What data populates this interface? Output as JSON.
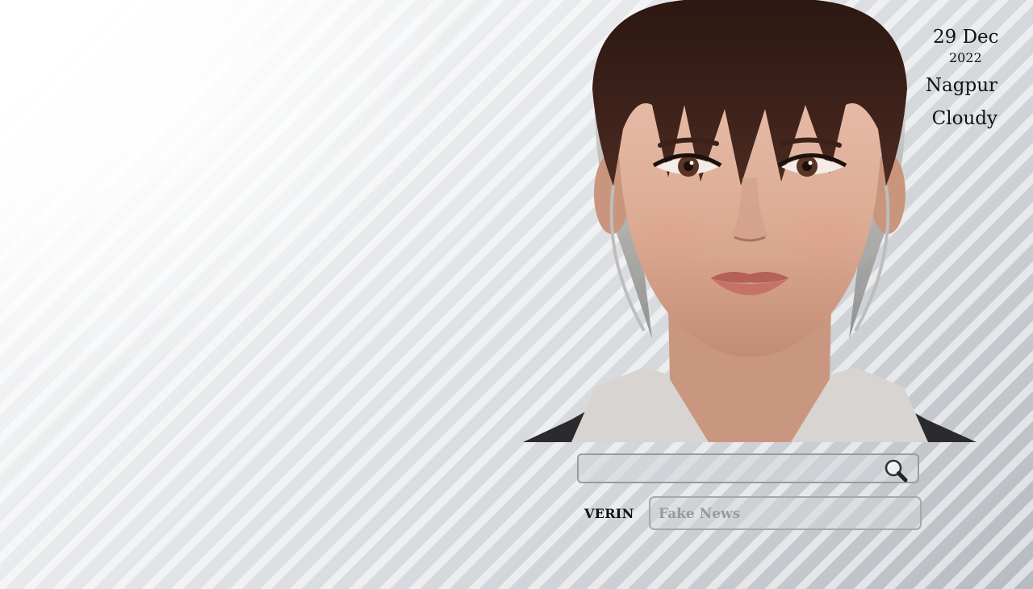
{
  "info": {
    "date_day": "29 Dec",
    "date_year": "2022",
    "city": "Nagpur",
    "weather": "Cloudy"
  },
  "search": {
    "value": "",
    "placeholder": "",
    "icon": "magnifier-icon"
  },
  "result": {
    "brand_label": "VERIN",
    "value": "Fake News"
  },
  "avatar": {
    "icon": "assistant-avatar"
  },
  "colors": {
    "text": "#111111",
    "muted": "#9a9a9a",
    "border": "#9a9a9a"
  }
}
